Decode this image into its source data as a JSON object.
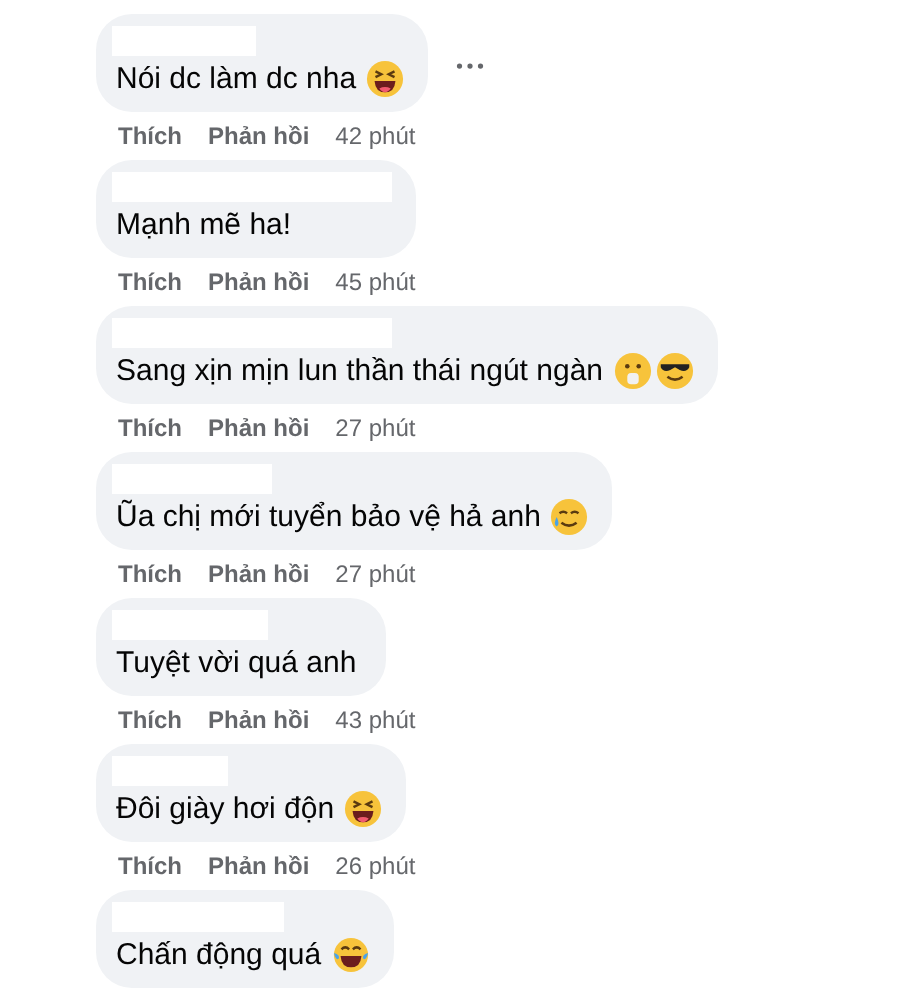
{
  "comments": [
    {
      "text": "Nói dc làm dc nha",
      "more_options": true,
      "like": "Thích",
      "reply": "Phản hồi",
      "time": "42 phút"
    },
    {
      "text": "Mạnh mẽ ha!",
      "more_options": false,
      "like": "Thích",
      "reply": "Phản hồi",
      "time": "45 phút"
    },
    {
      "text": "Sang xịn mịn lun thần thái ngút ngàn",
      "more_options": false,
      "like": "Thích",
      "reply": "Phản hồi",
      "time": "27 phút"
    },
    {
      "text": "Ũa chị mới tuyển bảo vệ hả anh",
      "more_options": false,
      "like": "Thích",
      "reply": "Phản hồi",
      "time": "27 phút"
    },
    {
      "text": "Tuyệt vời quá anh",
      "more_options": false,
      "like": "Thích",
      "reply": "Phản hồi",
      "time": "43 phút"
    },
    {
      "text": "Đôi giày hơi độn",
      "more_options": false,
      "like": "Thích",
      "reply": "Phản hồi",
      "time": "26 phút"
    },
    {
      "text": "Chấn động quá",
      "more_options": false
    }
  ]
}
